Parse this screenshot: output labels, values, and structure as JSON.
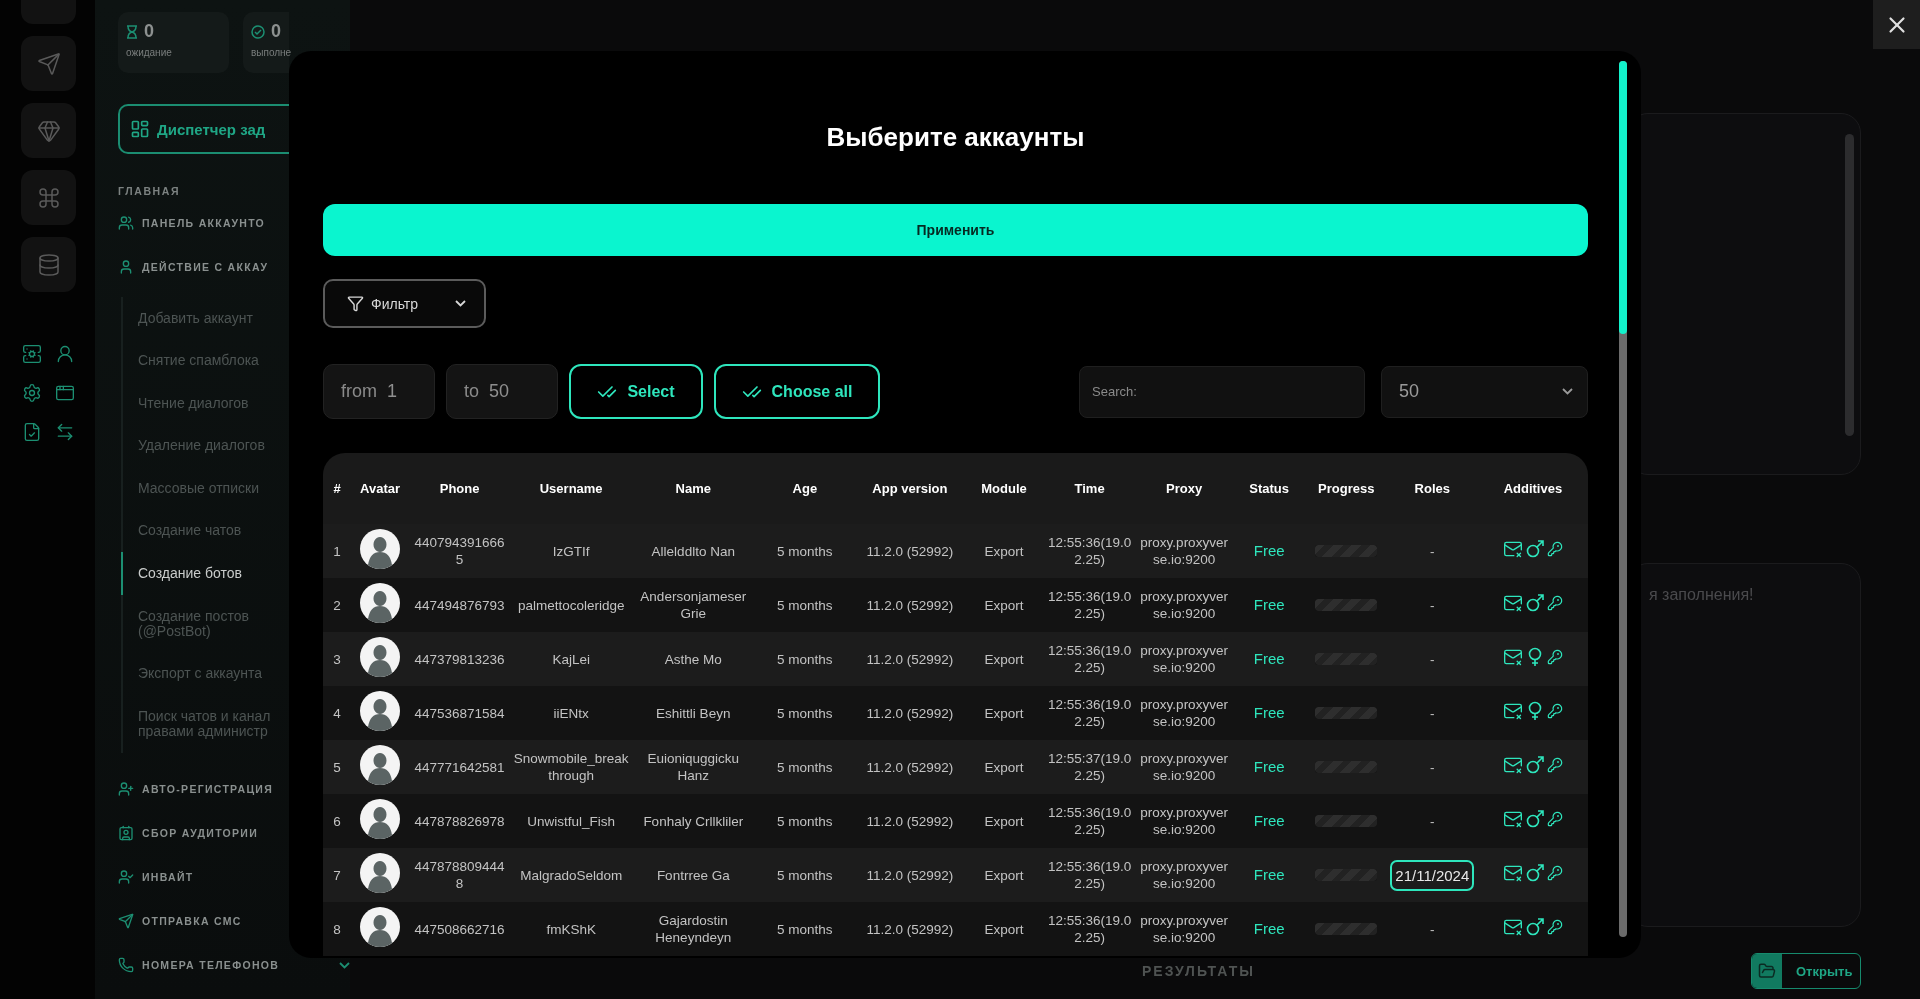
{
  "sidebar": {
    "stats": [
      {
        "value": "0",
        "label": "ожидание"
      },
      {
        "value": "0",
        "label": "выполне"
      }
    ],
    "dispatcher_button": "Диспетчер зад",
    "sections": [
      {
        "kind": "heading",
        "label": "ГЛАВНАЯ"
      },
      {
        "kind": "section",
        "label": "ПАНЕЛЬ АККАУНТО"
      },
      {
        "kind": "section",
        "label": "ДЕЙСТВИЕ С АККАУ",
        "children": [
          {
            "label": "Добавить аккаунт",
            "selected": false
          },
          {
            "label": "Снятие спамблока",
            "selected": false
          },
          {
            "label": "Чтение диалогов",
            "selected": false
          },
          {
            "label": "Удаление диалогов",
            "selected": false
          },
          {
            "label": "Массовые отписки",
            "selected": false
          },
          {
            "label": "Создание чатов",
            "selected": false
          },
          {
            "label": "Создание ботов",
            "selected": true
          },
          {
            "label": "Создание постов (@PostBot)",
            "selected": false
          },
          {
            "label": "Экспорт с аккаунта",
            "selected": false
          },
          {
            "label": "Поиск чатов и канал правами администр",
            "selected": false
          }
        ]
      },
      {
        "kind": "section",
        "label": "АВТО-РЕГИСТРАЦИЯ"
      },
      {
        "kind": "section",
        "label": "СБОР АУДИТОРИИ"
      },
      {
        "kind": "section",
        "label": "ИНВАЙТ"
      },
      {
        "kind": "section",
        "label": "ОТПРАВКА СМС"
      },
      {
        "kind": "section",
        "label": "НОМЕРА ТЕЛЕФОНОВ",
        "expanded": false
      }
    ]
  },
  "main": {
    "notes_field": {
      "placeholder": "я заполнения!"
    },
    "results_label": "РЕЗУЛЬТАТЫ",
    "open_button": "Открыть"
  },
  "modal": {
    "title": "Выберите аккаунты",
    "apply_button": "Применить",
    "filter": {
      "label": "Фильтр"
    },
    "range": {
      "from": {
        "label": "from",
        "value": "1"
      },
      "to": {
        "label": "to",
        "value": "50"
      }
    },
    "select_button": "Select",
    "choose_all_button": "Choose all",
    "search": {
      "placeholder": "Search:"
    },
    "page_size": {
      "value": "50"
    },
    "table": {
      "columns": [
        "#",
        "Avatar",
        "Phone",
        "Username",
        "Name",
        "Age",
        "App version",
        "Module",
        "Time",
        "Proxy",
        "Status",
        "Progress",
        "Roles",
        "Additives"
      ],
      "rows": [
        {
          "index": "1",
          "phone": "4407943916665",
          "username": "IzGTIf",
          "name": "Allelddlto Nan",
          "age": "5 months",
          "app_version": "11.2.0 (52992)",
          "module": "Export",
          "time": "12:55:36(19.02.25)",
          "proxy": "proxy.proxyverse.io:9200",
          "status": "Free",
          "progress": {
            "level": 1
          },
          "roles": {
            "kind": "plain",
            "text": "-"
          },
          "additives": {
            "female": false
          }
        },
        {
          "index": "2",
          "phone": "447494876793",
          "username": "palmettocoleridge",
          "name": "Andersonjameser Grie",
          "age": "5 months",
          "app_version": "11.2.0 (52992)",
          "module": "Export",
          "time": "12:55:36(19.02.25)",
          "proxy": "proxy.proxyverse.io:9200",
          "status": "Free",
          "progress": {
            "level": 1
          },
          "roles": {
            "kind": "plain",
            "text": "-"
          },
          "additives": {
            "female": false
          }
        },
        {
          "index": "3",
          "phone": "447379813236",
          "username": "KajLei",
          "name": "Asthe Mo",
          "age": "5 months",
          "app_version": "11.2.0 (52992)",
          "module": "Export",
          "time": "12:55:36(19.02.25)",
          "proxy": "proxy.proxyverse.io:9200",
          "status": "Free",
          "progress": {
            "level": 1
          },
          "roles": {
            "kind": "plain",
            "text": "-"
          },
          "additives": {
            "female": true
          }
        },
        {
          "index": "4",
          "phone": "447536871584",
          "username": "iiENtx",
          "name": "Eshittli Beyn",
          "age": "5 months",
          "app_version": "11.2.0 (52992)",
          "module": "Export",
          "time": "12:55:36(19.02.25)",
          "proxy": "proxy.proxyverse.io:9200",
          "status": "Free",
          "progress": {
            "level": 1
          },
          "roles": {
            "kind": "plain",
            "text": "-"
          },
          "additives": {
            "female": true
          }
        },
        {
          "index": "5",
          "phone": "447771642581",
          "username": "Snowmobile_breakthrough",
          "name": "Euioniquggicku Hanz",
          "age": "5 months",
          "app_version": "11.2.0 (52992)",
          "module": "Export",
          "time": "12:55:37(19.02.25)",
          "proxy": "proxy.proxyverse.io:9200",
          "status": "Free",
          "progress": {
            "level": 1
          },
          "roles": {
            "kind": "plain",
            "text": "-"
          },
          "additives": {
            "female": false
          }
        },
        {
          "index": "6",
          "phone": "447878826978",
          "username": "Unwistful_Fish",
          "name": "Fonhaly Crllkliler",
          "age": "5 months",
          "app_version": "11.2.0 (52992)",
          "module": "Export",
          "time": "12:55:36(19.02.25)",
          "proxy": "proxy.proxyverse.io:9200",
          "status": "Free",
          "progress": {
            "level": 1
          },
          "roles": {
            "kind": "plain",
            "text": "-"
          },
          "additives": {
            "female": false
          }
        },
        {
          "index": "7",
          "phone": "4478788094448",
          "username": "MalgradoSeldom",
          "name": "Fontrree Ga",
          "age": "5 months",
          "app_version": "11.2.0 (52992)",
          "module": "Export",
          "time": "12:55:36(19.02.25)",
          "proxy": "proxy.proxyverse.io:9200",
          "status": "Free",
          "progress": {
            "level": 1
          },
          "roles": {
            "kind": "badge",
            "text": "21/11/2024"
          },
          "additives": {
            "female": false
          }
        },
        {
          "index": "8",
          "phone": "447508662716",
          "username": "fmKShK",
          "name": "Gajardostin Heneyndeyn",
          "age": "5 months",
          "app_version": "11.2.0 (52992)",
          "module": "Export",
          "time": "12:55:36(19.02.25)",
          "proxy": "proxy.proxyverse.io:9200",
          "status": "Free",
          "progress": {
            "level": 1
          },
          "roles": {
            "kind": "plain",
            "text": "-"
          },
          "additives": {
            "female": false
          }
        }
      ]
    }
  }
}
